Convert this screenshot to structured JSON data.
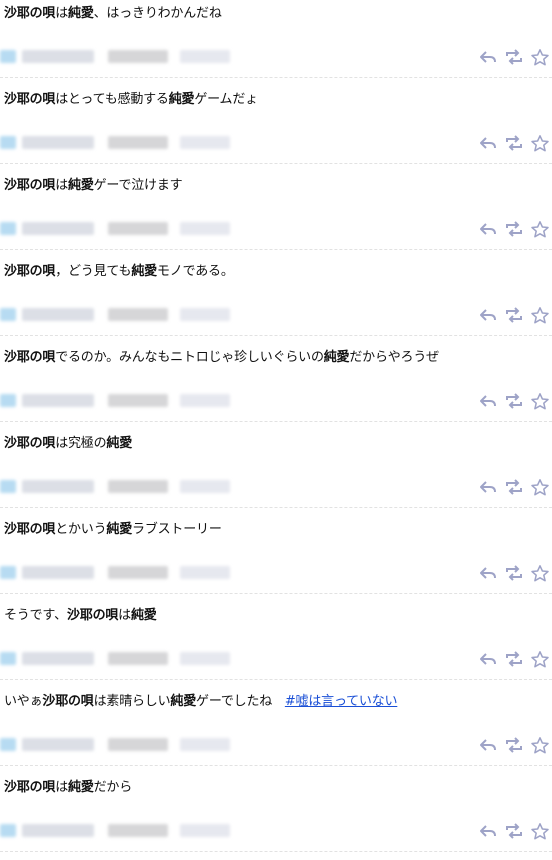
{
  "tweets": [
    {
      "parts": [
        {
          "t": "沙耶の唄",
          "b": true
        },
        {
          "t": "は"
        },
        {
          "t": "純愛",
          "b": true
        },
        {
          "t": "、はっきりわかんだね"
        }
      ]
    },
    {
      "parts": [
        {
          "t": "沙耶の唄",
          "b": true
        },
        {
          "t": "はとっても感動する"
        },
        {
          "t": "純愛",
          "b": true
        },
        {
          "t": "ゲームだょ"
        }
      ]
    },
    {
      "parts": [
        {
          "t": "沙耶の唄",
          "b": true
        },
        {
          "t": "は"
        },
        {
          "t": "純愛",
          "b": true
        },
        {
          "t": "ゲーで泣けます"
        }
      ]
    },
    {
      "parts": [
        {
          "t": "沙耶の唄",
          "b": true
        },
        {
          "t": "，どう見ても"
        },
        {
          "t": "純愛",
          "b": true
        },
        {
          "t": "モノである。"
        }
      ]
    },
    {
      "parts": [
        {
          "t": "沙耶の唄",
          "b": true
        },
        {
          "t": "でるのか。みんなもニトロじゃ珍しいぐらいの"
        },
        {
          "t": "純愛",
          "b": true
        },
        {
          "t": "だからやろうぜ"
        }
      ]
    },
    {
      "parts": [
        {
          "t": "沙耶の唄",
          "b": true
        },
        {
          "t": "は究極の"
        },
        {
          "t": "純愛",
          "b": true
        }
      ]
    },
    {
      "parts": [
        {
          "t": "沙耶の唄",
          "b": true
        },
        {
          "t": "とかいう"
        },
        {
          "t": "純愛",
          "b": true
        },
        {
          "t": "ラブストーリー"
        }
      ]
    },
    {
      "parts": [
        {
          "t": "そうです、"
        },
        {
          "t": "沙耶の唄",
          "b": true
        },
        {
          "t": "は"
        },
        {
          "t": "純愛",
          "b": true
        }
      ]
    },
    {
      "parts": [
        {
          "t": "いやぁ"
        },
        {
          "t": "沙耶の唄",
          "b": true
        },
        {
          "t": "は素晴らしい"
        },
        {
          "t": "純愛",
          "b": true
        },
        {
          "t": "ゲーでしたね　"
        },
        {
          "t": "#嘘は言っていない",
          "link": true
        }
      ]
    },
    {
      "parts": [
        {
          "t": "沙耶の唄",
          "b": true
        },
        {
          "t": "は"
        },
        {
          "t": "純愛",
          "b": true
        },
        {
          "t": "だから"
        }
      ]
    }
  ],
  "actions": [
    {
      "name": "reply",
      "icon": "reply-icon"
    },
    {
      "name": "retweet",
      "icon": "retweet-icon"
    },
    {
      "name": "favorite",
      "icon": "star-icon"
    }
  ],
  "colors": {
    "icon": "#9ea3c7",
    "link": "#1a4fd6",
    "separator": "#e2e2e2"
  }
}
